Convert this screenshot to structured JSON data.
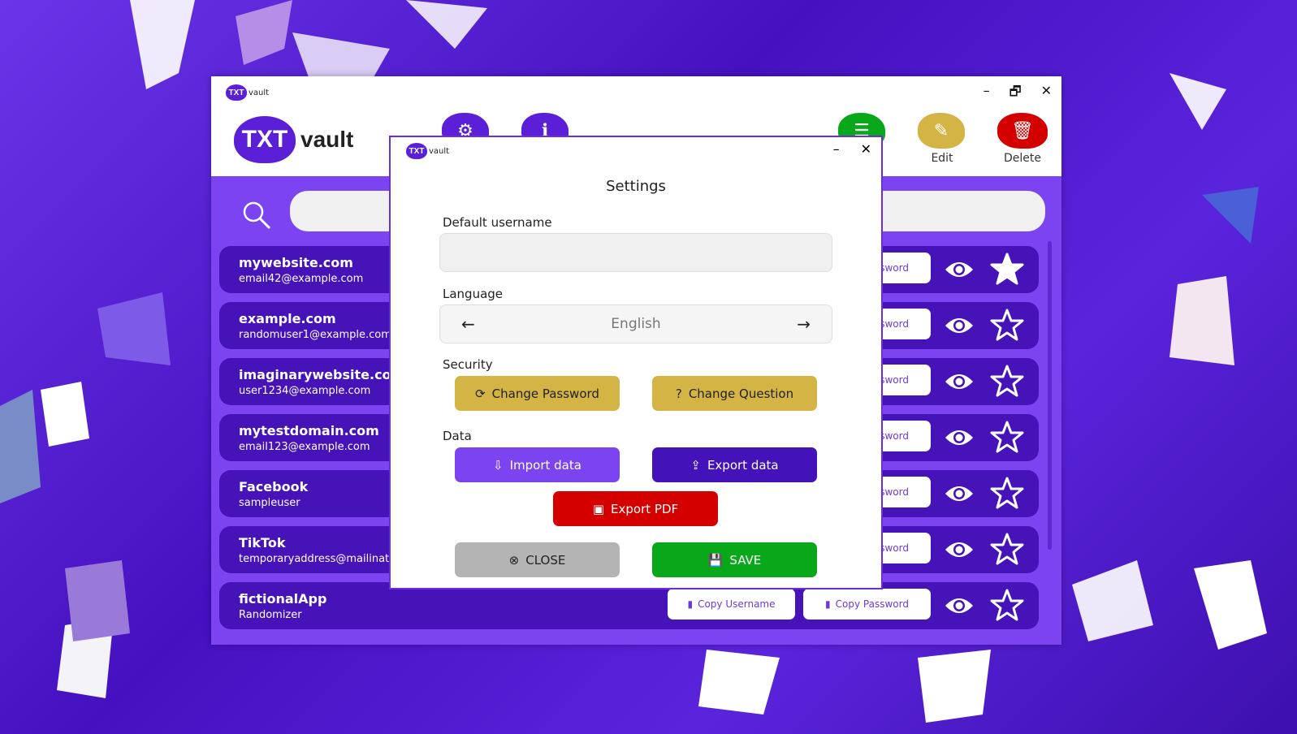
{
  "app": {
    "logo_mark": "TXT",
    "logo_text": "vault",
    "window_controls": [
      "–",
      "🗗",
      "✕"
    ]
  },
  "header": {
    "settings_icon": "gear-icon",
    "info_icon": "info-icon",
    "notes_icon": "notes-icon",
    "edit_label": "Edit",
    "delete_label": "Delete"
  },
  "search": {
    "placeholder": ""
  },
  "entries": [
    {
      "site": "mywebsite.com",
      "user": "email42@example.com",
      "favorite": true
    },
    {
      "site": "example.com",
      "user": "randomuser1@example.com",
      "favorite": false
    },
    {
      "site": "imaginarywebsite.com",
      "user": "user1234@example.com",
      "favorite": false
    },
    {
      "site": "mytestdomain.com",
      "user": "email123@example.com",
      "favorite": false
    },
    {
      "site": "Facebook",
      "user": "sampleuser",
      "favorite": false
    },
    {
      "site": "TikTok",
      "user": "temporaryaddress@mailinator",
      "favorite": false
    },
    {
      "site": "fictionalApp",
      "user": "Randomizer",
      "favorite": false
    }
  ],
  "row_buttons": {
    "copy_username": "Copy  Username",
    "copy_password": "Copy  Password"
  },
  "dialog": {
    "logo_mark": "TXT",
    "logo_text": "vault",
    "minimize": "–",
    "close": "✕",
    "title": "Settings",
    "default_username_label": "Default username",
    "default_username_value": "",
    "language_label": "Language",
    "language_value": "English",
    "lang_prev": "←",
    "lang_next": "→",
    "security_label": "Security",
    "change_password": "Change  Password",
    "change_question": "Change  Question",
    "data_label": "Data",
    "import_data": "Import  data",
    "export_data": "Export  data",
    "export_pdf": "Export  PDF",
    "close_button": "CLOSE",
    "save_button": "SAVE"
  },
  "colors": {
    "primary": "#7b44f0",
    "row": "#4513b8",
    "gold": "#d4b445",
    "red": "#d40000",
    "green": "#08a81a",
    "gray": "#b4b4b4",
    "dark_purple": "#4312b8"
  }
}
